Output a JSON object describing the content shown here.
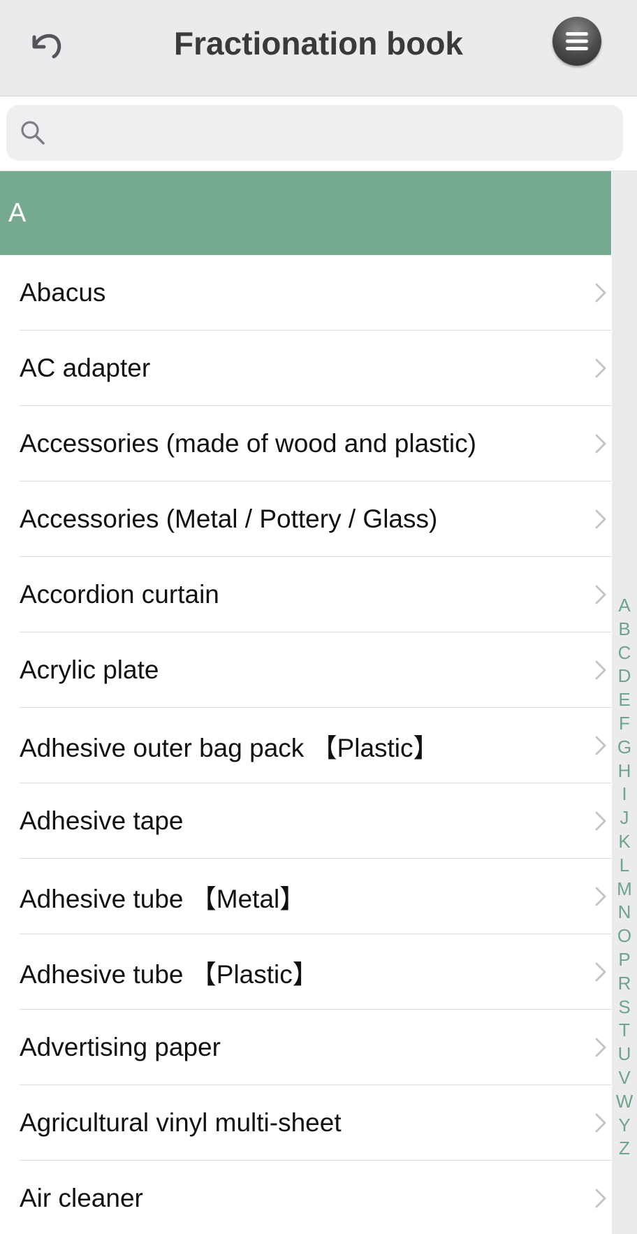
{
  "header": {
    "title": "Fractionation book"
  },
  "search": {
    "placeholder": "",
    "value": ""
  },
  "section": {
    "letter": "A"
  },
  "items": [
    "Abacus",
    "AC adapter",
    "Accessories (made of wood and plastic)",
    "Accessories (Metal / Pottery / Glass)",
    "Accordion curtain",
    "Acrylic plate",
    "Adhesive outer bag pack 【Plastic】",
    "Adhesive tape",
    "Adhesive tube 【Metal】",
    "Adhesive tube 【Plastic】",
    "Advertising paper",
    "Agricultural vinyl multi-sheet",
    "Air cleaner"
  ],
  "index_letters": [
    "A",
    "B",
    "C",
    "D",
    "E",
    "F",
    "G",
    "H",
    "I",
    "J",
    "K",
    "L",
    "M",
    "N",
    "O",
    "P",
    "R",
    "S",
    "T",
    "U",
    "V",
    "W",
    "Y",
    "Z"
  ],
  "colors": {
    "accent": "#75aa91",
    "index_text": "#6fa48a",
    "header_bg": "#ebebed"
  },
  "icons": {
    "back": "undo-icon",
    "menu": "menu-icon",
    "search": "search-icon",
    "row": "chevron-right-icon"
  }
}
